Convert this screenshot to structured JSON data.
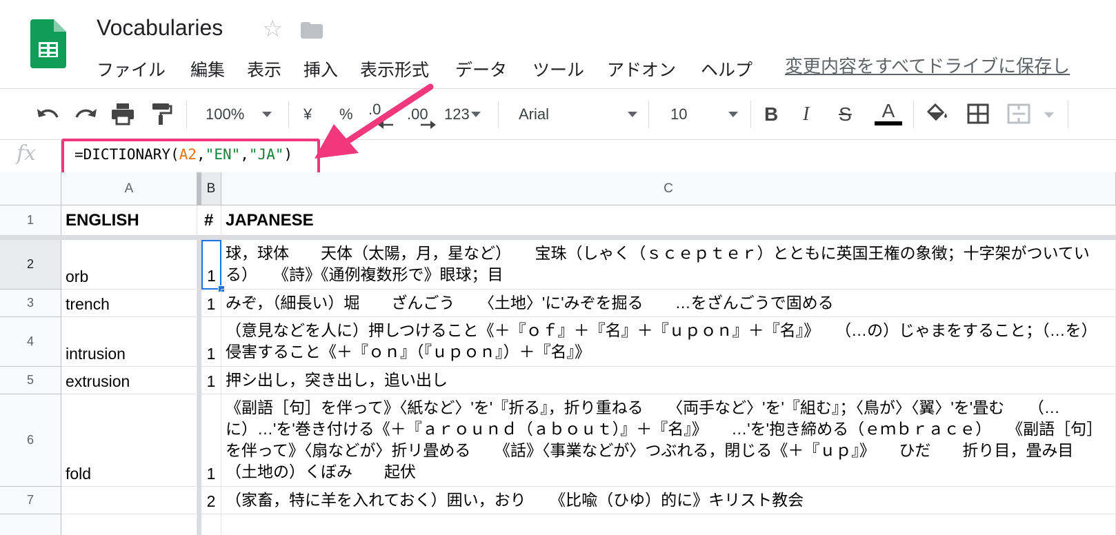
{
  "app": {
    "title": "Vocabularies",
    "menu": [
      "ファイル",
      "編集",
      "表示",
      "挿入",
      "表示形式",
      "データ",
      "ツール",
      "アドオン",
      "ヘルプ"
    ],
    "save_status": "変更内容をすべてドライブに保存し"
  },
  "toolbar": {
    "zoom": "100%",
    "currency": "¥",
    "percent": "%",
    "decimal_decrease": ".0",
    "decimal_increase": ".00",
    "more_formats": "123",
    "font": "Arial",
    "font_size": "10",
    "bold": "B",
    "italic": "I",
    "strike": "S",
    "text_color": "A"
  },
  "formula_bar": {
    "fx": "fx",
    "prefix": "=DICTIONARY(",
    "ref": "A2",
    "sep1": ",",
    "arg2": "\"EN\"",
    "sep2": ",",
    "arg3": "\"JA\"",
    "suffix": ")"
  },
  "colors": {
    "highlight": "#f2387d",
    "sheets_green": "#0f9d58",
    "ref_orange": "#e37400",
    "string_green": "#188038"
  },
  "grid": {
    "columns": [
      "A",
      "B",
      "C"
    ],
    "rows": [
      {
        "num": "1",
        "a": "ENGLISH",
        "b": "#",
        "c": "JAPANESE"
      },
      {
        "num": "2",
        "a": "orb",
        "b": "1",
        "c": "球，球体　　天体（太陽，月，星など）　　宝珠（しゃく（ｓｃｅｐｔｅｒ）とともに英国王権の象徴；十字架がついている）　　《詩》《通例複数形で》眼球；目"
      },
      {
        "num": "3",
        "a": "trench",
        "b": "1",
        "c": "みぞ，（細長い）堀　　ざんごう　　〈土地〉'に'みぞを掘る　　…をざんごうで固める"
      },
      {
        "num": "4",
        "a": "intrusion",
        "b": "1",
        "c": "（意見などを人に）押しつけること《＋『ｏｆ』＋『名』＋『ｕｐｏｎ』＋『名』》　　（…の）じゃまをすること；（…を）侵害すること《＋『ｏｎ』（『ｕｐｏｎ』）＋『名』》"
      },
      {
        "num": "5",
        "a": "extrusion",
        "b": "1",
        "c": "押シ出し，突き出し，追い出し"
      },
      {
        "num": "6",
        "a": "fold",
        "b": "1",
        "c": "《副語［句］を伴って》〈紙など〉'を'『折る』，折り重ねる　　〈両手など〉'を'『組む』；〈鳥が〉〈翼〉'を'畳む　　（…に）…'を'巻き付ける《＋『ａｒｏｕｎｄ（ａｂｏｕｔ）』＋『名』》　　…'を'抱き締める（ｅｍｂｒａｃｅ）　　《副語［句］を伴って》〈扇などが〉折リ畳める　　《話》〈事業などが〉つぶれる，閉じる《＋『ｕｐ』》　　ひだ　　折り目，畳み目　　（土地の）くぼみ　　起伏"
      },
      {
        "num": "7",
        "a": "",
        "b": "2",
        "c": "（家畜，特に羊を入れておく）囲い，おり　　《比喩（ひゆ）的に》キリスト教会"
      }
    ]
  }
}
